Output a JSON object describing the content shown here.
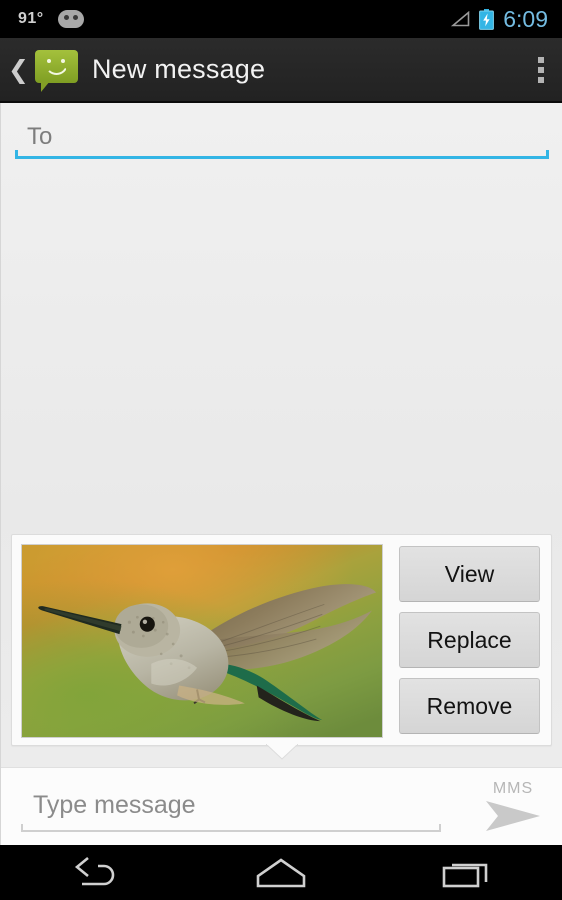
{
  "statusbar": {
    "temperature": "91°",
    "face_icon": "android-face-icon",
    "signal_icon": "signal-triangle-icon",
    "battery_icon": "battery-charging-icon",
    "time": "6:09",
    "time_color": "#74bce2",
    "battery_color": "#33b5e5"
  },
  "actionbar": {
    "back_glyph": "❮",
    "app_icon": "messaging-bubble-icon",
    "title": "New message",
    "overflow_icon": "overflow-menu-icon",
    "accent_green": "#a4c13c",
    "background": "#2b2b2b"
  },
  "recipient": {
    "placeholder": "To",
    "value": "",
    "underline_color": "#33b5e5"
  },
  "attachment": {
    "thumbnail_alt": "hummingbird-photo",
    "buttons": [
      {
        "label": "View",
        "name": "view-button"
      },
      {
        "label": "Replace",
        "name": "replace-button"
      },
      {
        "label": "Remove",
        "name": "remove-button"
      }
    ]
  },
  "compose": {
    "placeholder": "Type message",
    "value": "",
    "mms_label": "MMS",
    "send_icon": "send-arrow-icon"
  },
  "navbar": {
    "back_icon": "nav-back-icon",
    "home_icon": "nav-home-icon",
    "recents_icon": "nav-recents-icon"
  }
}
